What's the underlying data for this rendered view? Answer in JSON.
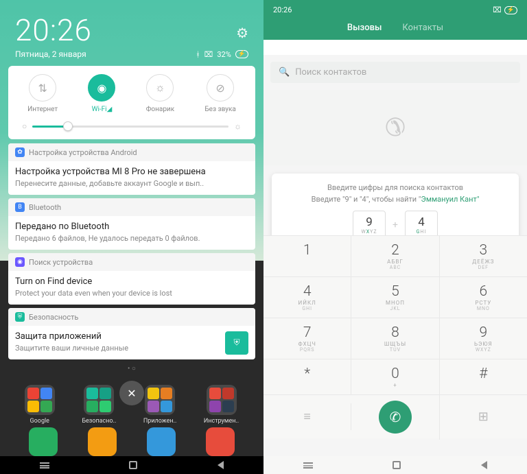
{
  "left": {
    "clock": "20:26",
    "date": "Пятница, 2 января",
    "battery": "32%",
    "qs": {
      "internet": "Интернет",
      "wifi": "Wi-Fi◢",
      "torch": "Фонарик",
      "silent": "Без звука"
    },
    "notifs": [
      {
        "app": "Настройка устройства Android",
        "title": "Настройка устройства MI 8 Pro не завершена",
        "text": "Перенесите данные, добавьте аккаунт Google и вып..",
        "color": "#4285f4",
        "icon": "✿"
      },
      {
        "app": "Bluetooth",
        "title": "Передано по Bluetooth",
        "text": "Передано 6 файлов, Не удалось передать 0 файлов.",
        "color": "#4285f4",
        "icon": "B"
      },
      {
        "app": "Поиск устройства",
        "title": "Turn on Find device",
        "text": "Protect your data even when your device is lost",
        "color": "#6b57ff",
        "icon": "◉"
      },
      {
        "app": "Безопасность",
        "title": "Защита приложений",
        "text": "Защитите ваши личные данные",
        "color": "#1abc9c",
        "icon": "⛨",
        "badge": true
      }
    ],
    "folders": [
      "Google",
      "Безопасно..",
      "Приложен..",
      "Инструмен.."
    ]
  },
  "right": {
    "clock": "20:26",
    "tabs": {
      "calls": "Вызовы",
      "contacts": "Контакты"
    },
    "search_ph": "Поиск контактов",
    "hint1": "Введите цифры для поиска контактов",
    "hint2a": "Введите \"9\" и \"4\", чтобы найти \"",
    "hint2b": "Эммануил ",
    "hint2c": "Кант\"",
    "k9": {
      "n": "9",
      "l": "WXYZ"
    },
    "k4": {
      "n": "4",
      "l": "GHI"
    },
    "pad": [
      [
        {
          "n": "1",
          "l1": "",
          "l2": ""
        },
        {
          "n": "2",
          "l1": "АБВГ",
          "l2": "ABC"
        },
        {
          "n": "3",
          "l1": "ДЕЁЖЗ",
          "l2": "DEF"
        }
      ],
      [
        {
          "n": "4",
          "l1": "ИЙКЛ",
          "l2": "GHI"
        },
        {
          "n": "5",
          "l1": "МНОП",
          "l2": "JKL"
        },
        {
          "n": "6",
          "l1": "РСТУ",
          "l2": "MNO"
        }
      ],
      [
        {
          "n": "7",
          "l1": "ФХЦЧ",
          "l2": "PQRS"
        },
        {
          "n": "8",
          "l1": "ШЩЪЫ",
          "l2": "TUV"
        },
        {
          "n": "9",
          "l1": "ЬЭЮЯ",
          "l2": "WXYZ"
        }
      ],
      [
        {
          "n": "*",
          "l1": "",
          "l2": ""
        },
        {
          "n": "0",
          "l1": "+",
          "l2": ""
        },
        {
          "n": "#",
          "l1": "",
          "l2": ""
        }
      ]
    ]
  }
}
